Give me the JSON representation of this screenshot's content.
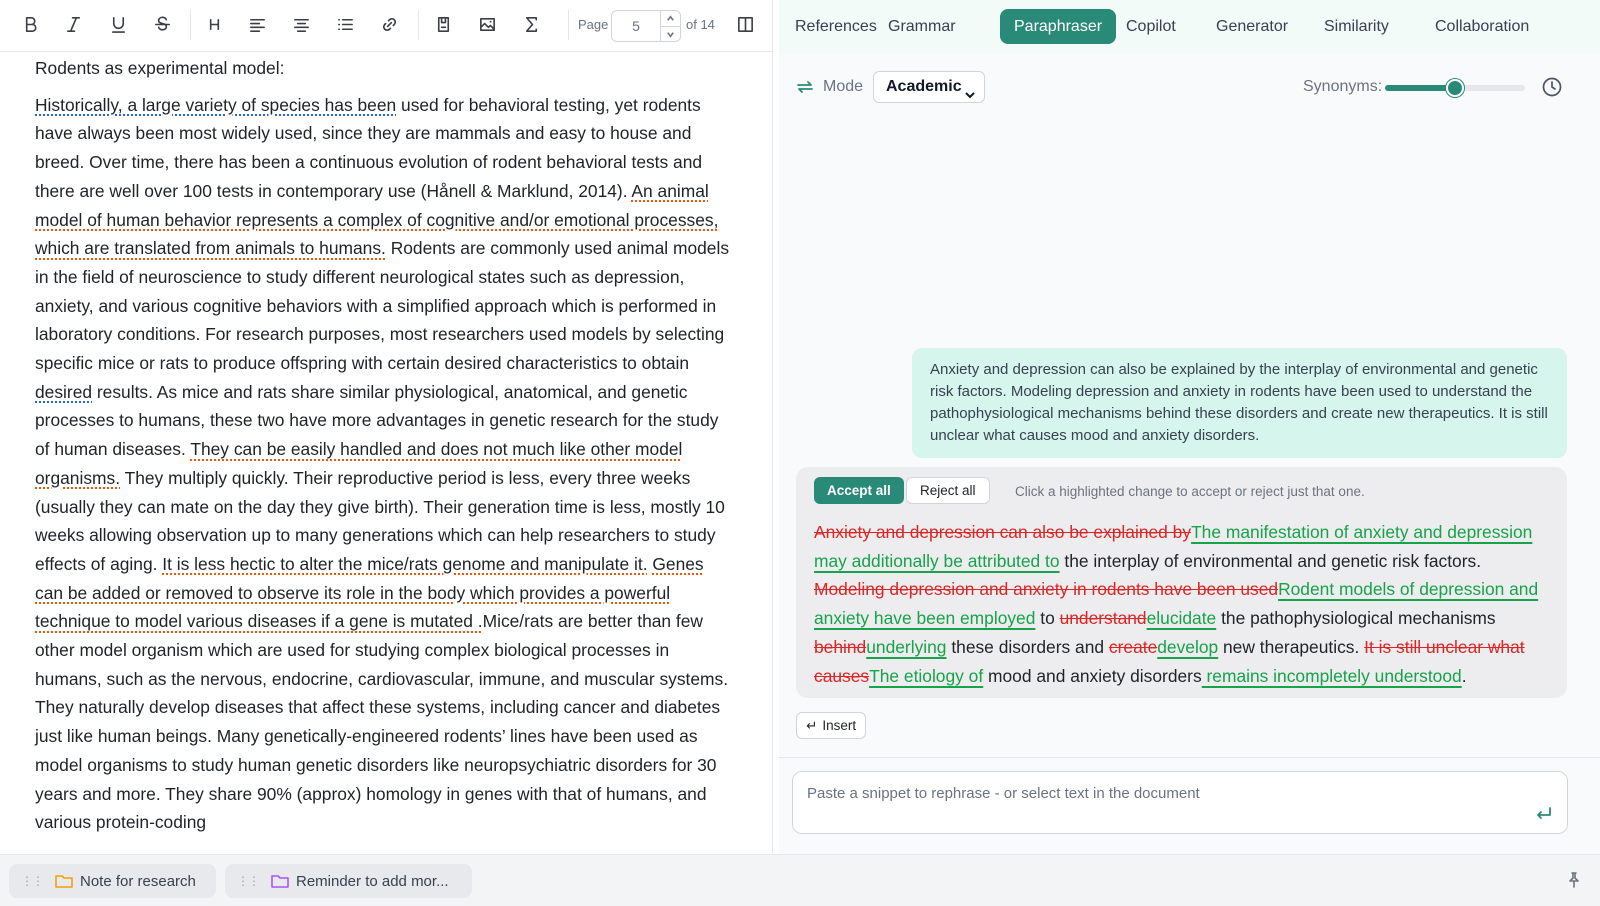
{
  "editor": {
    "toolbar": {
      "page_label": "Page",
      "page_value": "5",
      "page_total": "of 14"
    },
    "heading": "Rodents as experimental model:",
    "paragraph": [
      {
        "text": "Historically, a large variety of species has been",
        "mark": "blue"
      },
      {
        "text": " used for behavioral testing, yet rodents have always been most widely used, since they are mammals and easy to house and breed. Over time, there has been a continuous evolution of rodent behavioral tests and there are well over 100 tests in contemporary use (Hånell & Marklund, 2014). ",
        "mark": ""
      },
      {
        "text": "An animal model of human behavior represents a complex of cognitive and/or emotional processes, which are translated from animals to humans.",
        "mark": "orange"
      },
      {
        "text": " Rodents are commonly used animal models in the field of neuroscience to study different neurological states such as depression, anxiety, and various cognitive behaviors with a simplified approach which is performed in laboratory conditions. For research purposes, most researchers used models by selecting specific mice or rats to produce offspring with certain desired characteristics to obtain ",
        "mark": ""
      },
      {
        "text": "desired",
        "mark": "blue"
      },
      {
        "text": " results. As mice and rats share similar physiological, anatomical, and genetic processes to humans, these two have more advantages in genetic research for the study of human diseases. ",
        "mark": ""
      },
      {
        "text": "They can be easily handled and does not much like other model organisms.",
        "mark": "orange"
      },
      {
        "text": " They multiply quickly. Their reproductive period is less, every three weeks (usually they can mate on the day they give birth). Their generation time is less, mostly 10 weeks allowing observation up to many generations which can help researchers to study effects of aging.  ",
        "mark": ""
      },
      {
        "text": "It is less hectic to alter the mice/rats genome and manipulate it.",
        "mark": "orange"
      },
      {
        "text": " ",
        "mark": ""
      },
      {
        "text": "Genes can be added or removed to observe its role in the body which  provides a powerful technique to model various diseases if a gene is mutated .",
        "mark": "orange"
      },
      {
        "text": "Mice/rats are better than few other model organism which are used for studying complex biological processes in humans, such as the nervous, endocrine, cardiovascular, immune, and muscular systems. They naturally develop diseases that affect these systems, including cancer and diabetes just like human beings. Many genetically-engineered rodents’ lines have been used as model organisms to study human genetic disorders like neuropsychiatric disorders for 30 years and more. They share 90% (approx) homology in genes with that of humans, and various protein-coding",
        "mark": ""
      }
    ]
  },
  "panel": {
    "tabs": [
      "References",
      "Grammar",
      "Paraphraser",
      "Copilot",
      "Generator",
      "Similarity",
      "Collaboration"
    ],
    "active_tab": "Paraphraser",
    "mode_label": "Mode",
    "mode_value": "Academic",
    "synonyms_label": "Synonyms:",
    "synonyms_level": 0.5,
    "user_message": "Anxiety and depression can also be explained by the interplay of environmental and genetic risk factors. Modeling depression and anxiety in rodents have been used to understand the pathophysiological mechanisms behind these disorders and create new therapeutics. It is still unclear what causes mood and anxiety disorders.",
    "accept_all": "Accept all",
    "reject_all": "Reject all",
    "hint": "Click a highlighted change to accept or reject just that one.",
    "result": [
      {
        "t": "del",
        "text": "Anxiety and depression can also be explained by"
      },
      {
        "t": "ins",
        "text": "The manifestation of anxiety and depression may additionally be attributed to"
      },
      {
        "t": "keep",
        "text": " the interplay of environmental and genetic risk factors. "
      },
      {
        "t": "del",
        "text": "Modeling depression and anxiety in rodents have been used"
      },
      {
        "t": "ins",
        "text": "Rodent models of depression and anxiety have been employed"
      },
      {
        "t": "keep",
        "text": " to "
      },
      {
        "t": "del",
        "text": "understand"
      },
      {
        "t": "ins",
        "text": "elucidate"
      },
      {
        "t": "keep",
        "text": " the pathophysiological mechanisms "
      },
      {
        "t": "del",
        "text": "behind"
      },
      {
        "t": "ins",
        "text": "underlying"
      },
      {
        "t": "keep",
        "text": " these disorders and "
      },
      {
        "t": "del",
        "text": "create"
      },
      {
        "t": "ins",
        "text": "develop"
      },
      {
        "t": "keep",
        "text": " new therapeutics. "
      },
      {
        "t": "del",
        "text": "It is still unclear what causes"
      },
      {
        "t": "ins",
        "text": "The etiology of"
      },
      {
        "t": "keep",
        "text": " mood and anxiety disorders"
      },
      {
        "t": "ins",
        "text": " remains incompletely understood"
      },
      {
        "t": "keep",
        "text": "."
      }
    ],
    "insert_label": "Insert",
    "composer_placeholder": "Paste a snippet to rephrase - or select text in the document"
  },
  "bottom_bar": {
    "notes": [
      {
        "label": "Note for research",
        "color": "#f59e0b"
      },
      {
        "label": "Reminder to add mor...",
        "color": "#a855f7"
      }
    ]
  },
  "colors": {
    "accent": "#2a8a78",
    "deleted": "#dc2626",
    "inserted": "#16a34a",
    "grammar_mark": "#2563eb",
    "style_mark": "#ea580c"
  }
}
